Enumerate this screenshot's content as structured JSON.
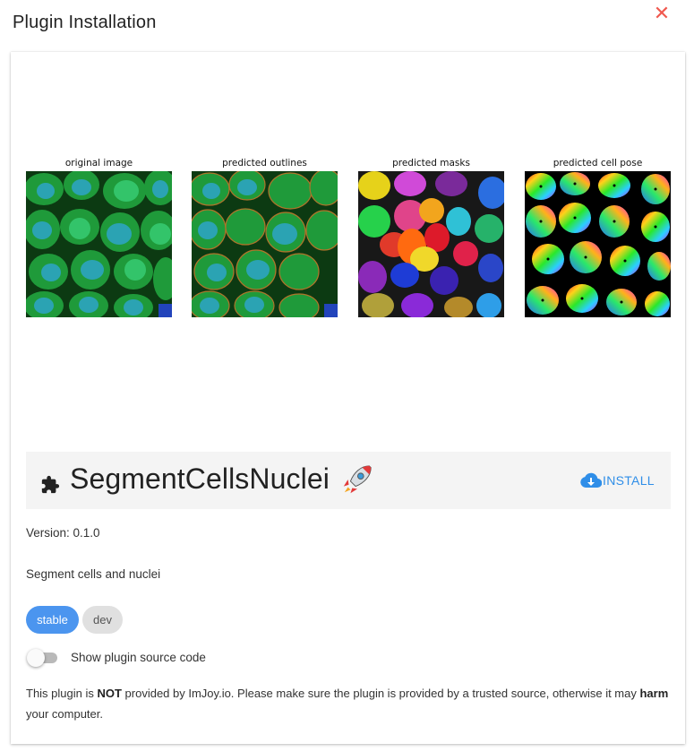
{
  "dialog": {
    "title": "Plugin Installation",
    "close_icon": "close-icon",
    "close_color": "#f0594f"
  },
  "preview": {
    "panels": [
      {
        "title": "original image"
      },
      {
        "title": "predicted outlines"
      },
      {
        "title": "predicted masks"
      },
      {
        "title": "predicted cell pose"
      }
    ]
  },
  "plugin": {
    "icon": "puzzle-icon",
    "name": "SegmentCellsNuclei",
    "emoji_icon": "rocket-icon",
    "install_label": "INSTALL",
    "install_icon": "cloud-download-icon",
    "accent": "#2f8ee8",
    "version_label": "Version: 0.1.0",
    "description": "Segment cells and nuclei"
  },
  "tags": [
    {
      "label": "stable",
      "active": true
    },
    {
      "label": "dev",
      "active": false
    }
  ],
  "source_toggle": {
    "label": "Show plugin source code",
    "on": false
  },
  "warning": {
    "part1": "This plugin is ",
    "not": "NOT",
    "part2": " provided by ImJoy.io. Please make sure the plugin is provided by a trusted source, otherwise it may ",
    "harm": "harm",
    "part3": " your computer."
  }
}
